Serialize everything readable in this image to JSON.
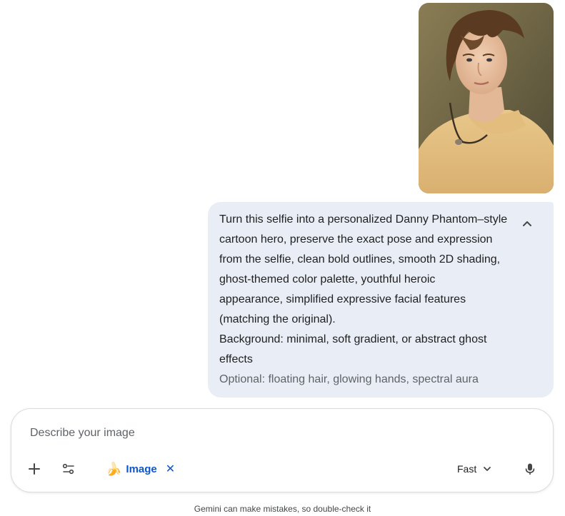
{
  "conversation": {
    "attachment": {
      "kind": "photo",
      "icon": "photo-thumbnail"
    },
    "prompt_lines": [
      "Turn this selfie into a personalized Danny Phantom–style",
      "cartoon hero, preserve the exact pose and expression",
      "from the selfie, clean bold outlines, smooth 2D shading,",
      "ghost-themed color palette, youthful heroic",
      "appearance, simplified expressive facial features",
      "(matching the original).",
      "Background: minimal, soft gradient, or abstract ghost",
      "effects",
      "Optional: floating hair, glowing hands, spectral aura"
    ],
    "collapse_icon": "chevron-up-icon"
  },
  "composer": {
    "placeholder": "Describe your image",
    "value": "",
    "add_icon": "plus-icon",
    "tools_icon": "tune-icon",
    "chip": {
      "emoji": "🍌",
      "label": "Image",
      "close": "✕"
    },
    "model_label": "Fast",
    "mic_icon": "mic-icon"
  },
  "footer": {
    "disclaimer": "Gemini can make mistakes, so double-check it"
  },
  "colors": {
    "accent": "#0b57d0",
    "bubble": "#e9eef6",
    "border": "#dadce0"
  }
}
